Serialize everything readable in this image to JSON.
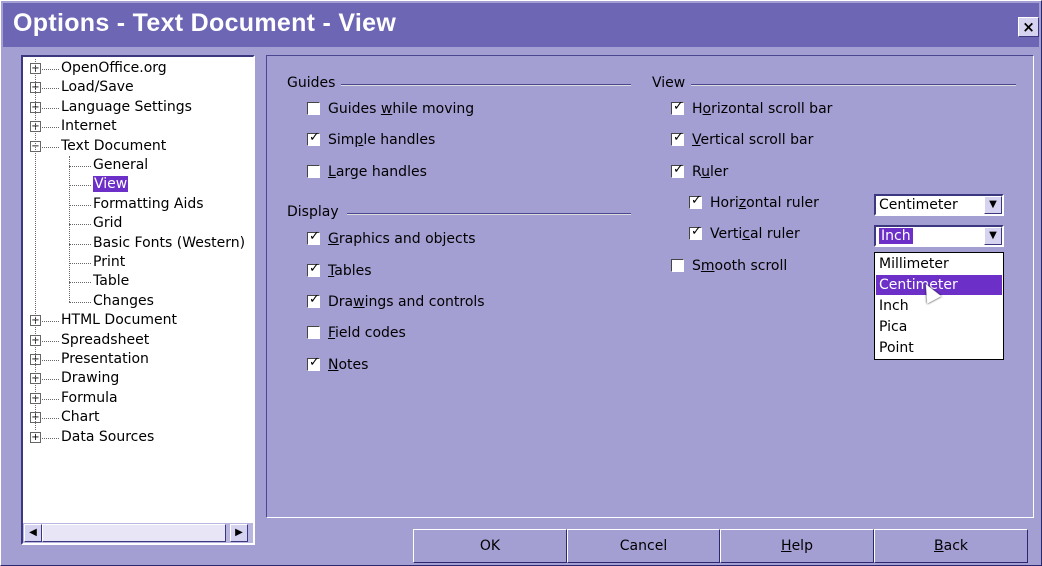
{
  "window": {
    "title": "Options - Text Document - View",
    "close_glyph": "×"
  },
  "tree": {
    "expand_glyph": "+",
    "collapse_glyph": "−",
    "items": [
      {
        "label": "OpenOffice.org"
      },
      {
        "label": "Load/Save"
      },
      {
        "label": "Language Settings"
      },
      {
        "label": "Internet"
      },
      {
        "label": "Text Document"
      },
      {
        "label": "General"
      },
      {
        "label": "View"
      },
      {
        "label": "Formatting Aids"
      },
      {
        "label": "Grid"
      },
      {
        "label": "Basic Fonts (Western)"
      },
      {
        "label": "Print"
      },
      {
        "label": "Table"
      },
      {
        "label": "Changes"
      },
      {
        "label": "HTML Document"
      },
      {
        "label": "Spreadsheet"
      },
      {
        "label": "Presentation"
      },
      {
        "label": "Drawing"
      },
      {
        "label": "Formula"
      },
      {
        "label": "Chart"
      },
      {
        "label": "Data Sources"
      }
    ],
    "selected": "View",
    "scroll_left_glyph": "◀",
    "scroll_right_glyph": "▶"
  },
  "guides": {
    "title": "Guides",
    "items": [
      {
        "pre": "Guides ",
        "key": "w",
        "post": "hile moving",
        "checked": false
      },
      {
        "pre": "Sim",
        "key": "p",
        "post": "le handles",
        "checked": true
      },
      {
        "pre": "",
        "key": "L",
        "post": "arge handles",
        "checked": false
      }
    ]
  },
  "display": {
    "title": "Display",
    "items": [
      {
        "pre": "",
        "key": "G",
        "post": "raphics and objects",
        "checked": true
      },
      {
        "pre": "",
        "key": "T",
        "post": "ables",
        "checked": true
      },
      {
        "pre": "Dra",
        "key": "w",
        "post": "ings and controls",
        "checked": true
      },
      {
        "pre": "",
        "key": "F",
        "post": "ield codes",
        "checked": false
      },
      {
        "pre": "",
        "key": "N",
        "post": "otes",
        "checked": true
      }
    ]
  },
  "view": {
    "title": "View",
    "items": [
      {
        "pre": "H",
        "key": "o",
        "post": "rizontal scroll bar",
        "checked": true
      },
      {
        "pre": "",
        "key": "V",
        "post": "ertical scroll bar",
        "checked": true
      },
      {
        "pre": "R",
        "key": "u",
        "post": "ler",
        "checked": true
      },
      {
        "pre": "Hori",
        "key": "z",
        "post": "ontal ruler",
        "checked": true
      },
      {
        "pre": "Verti",
        "key": "c",
        "post": "al ruler",
        "checked": true
      },
      {
        "pre": "S",
        "key": "m",
        "post": "ooth scroll",
        "checked": false
      }
    ],
    "tick_glyph": "✓",
    "horizontal_unit": "Centimeter",
    "vertical_unit": "Inch",
    "dropdown_arrow": "▼",
    "unit_options": [
      "Millimeter",
      "Centimeter",
      "Inch",
      "Pica",
      "Point"
    ],
    "highlighted_option": "Centimeter"
  },
  "buttons": {
    "ok": "OK",
    "cancel": "Cancel",
    "help_key": "H",
    "help_rest": "elp",
    "back_key": "B",
    "back_rest": "ack"
  }
}
